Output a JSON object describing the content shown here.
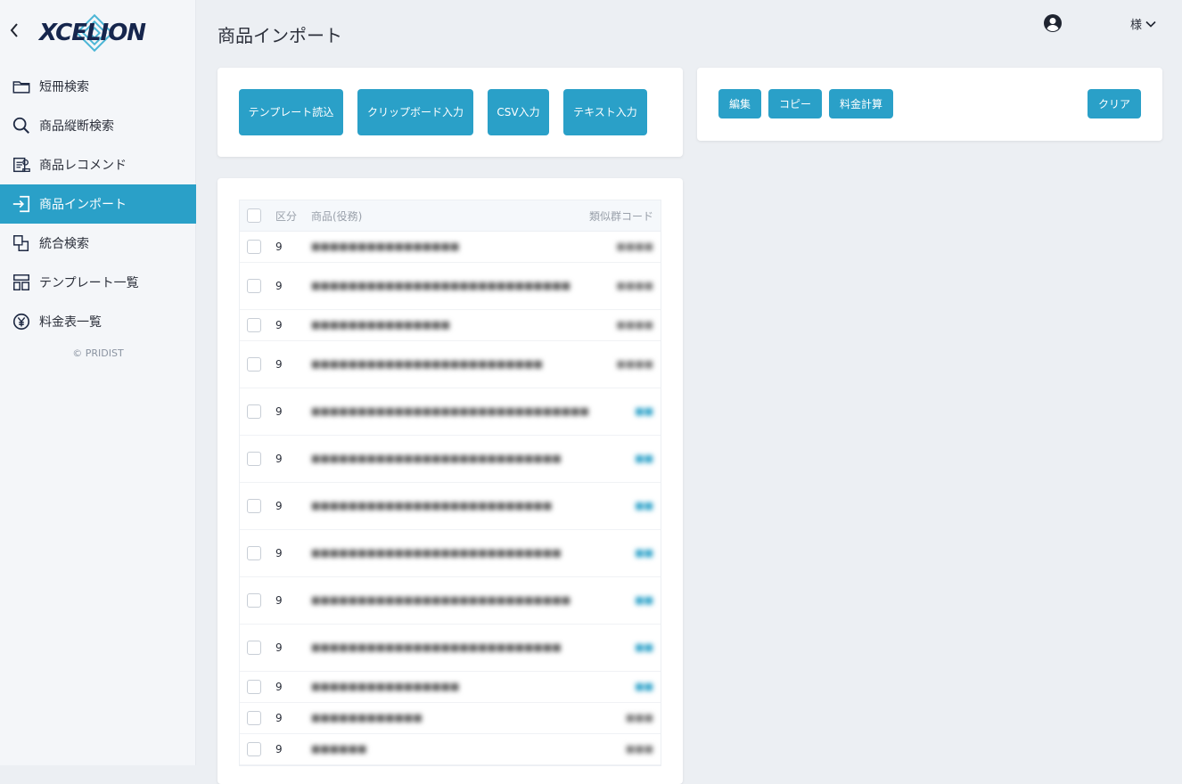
{
  "brand": {
    "logo_text": "XCELION",
    "colors": {
      "primary": "#2aa0c8",
      "logo_dark": "#16264d",
      "logo_accent": "#4cb6d6"
    }
  },
  "sidebar": {
    "back_icon": "chevron-left-icon",
    "items": [
      {
        "label": "短冊検索",
        "icon": "folder-icon",
        "active": false
      },
      {
        "label": "商品縦断検索",
        "icon": "search-icon",
        "active": false
      },
      {
        "label": "商品レコメンド",
        "icon": "recommend-icon",
        "active": false
      },
      {
        "label": "商品インポート",
        "icon": "import-icon",
        "active": true
      },
      {
        "label": "統合検索",
        "icon": "layers-icon",
        "active": false
      },
      {
        "label": "テンプレート一覧",
        "icon": "template-icon",
        "active": false
      },
      {
        "label": "料金表一覧",
        "icon": "yen-icon",
        "active": false
      }
    ],
    "copyright": "© PRIDIST"
  },
  "header": {
    "title": "商品インポート",
    "user_suffix": "様",
    "user_icon": "account-circle-icon"
  },
  "import_buttons": {
    "template_load": "テンプレート読込",
    "clipboard": "クリップボード入力",
    "csv": "CSV入力",
    "text": "テキスト入力"
  },
  "action_buttons": {
    "edit": "編集",
    "copy": "コピー",
    "calc": "料金計算",
    "clear": "クリア"
  },
  "table": {
    "columns": {
      "kubun": "区分",
      "product": "商品(役務)",
      "code": "類似群コード"
    },
    "rows": [
      {
        "kubun": "9",
        "product": "■■■■■■■■■■■■■■■■",
        "code": "■■■■"
      },
      {
        "kubun": "9",
        "product": "■■■■■■■■■■■■■■■■■■■■■■■■■■■■",
        "code": "■■■■"
      },
      {
        "kubun": "9",
        "product": "■■■■■■■■■■■■■■■",
        "code": "■■■■"
      },
      {
        "kubun": "9",
        "product": "■■■■■■■■■■■■■■■■■■■■■■■■■",
        "code": "■■■■"
      },
      {
        "kubun": "9",
        "product": "■■■■■■■■■■■■■■■■■■■■■■■■■■■■■■",
        "code": "■■"
      },
      {
        "kubun": "9",
        "product": "■■■■■■■■■■■■■■■■■■■■■■■■■■■",
        "code": "■■"
      },
      {
        "kubun": "9",
        "product": "■■■■■■■■■■■■■■■■■■■■■■■■■■",
        "code": "■■"
      },
      {
        "kubun": "9",
        "product": "■■■■■■■■■■■■■■■■■■■■■■■■■■■",
        "code": "■■"
      },
      {
        "kubun": "9",
        "product": "■■■■■■■■■■■■■■■■■■■■■■■■■■■■",
        "code": "■■"
      },
      {
        "kubun": "9",
        "product": "■■■■■■■■■■■■■■■■■■■■■■■■■■■",
        "code": "■■"
      },
      {
        "kubun": "9",
        "product": "■■■■■■■■■■■■■■■■",
        "code": "■■"
      },
      {
        "kubun": "9",
        "product": "■■■■■■■■■■■■",
        "code": "■■■"
      },
      {
        "kubun": "9",
        "product": "■■■■■■",
        "code": "■■■"
      }
    ]
  }
}
